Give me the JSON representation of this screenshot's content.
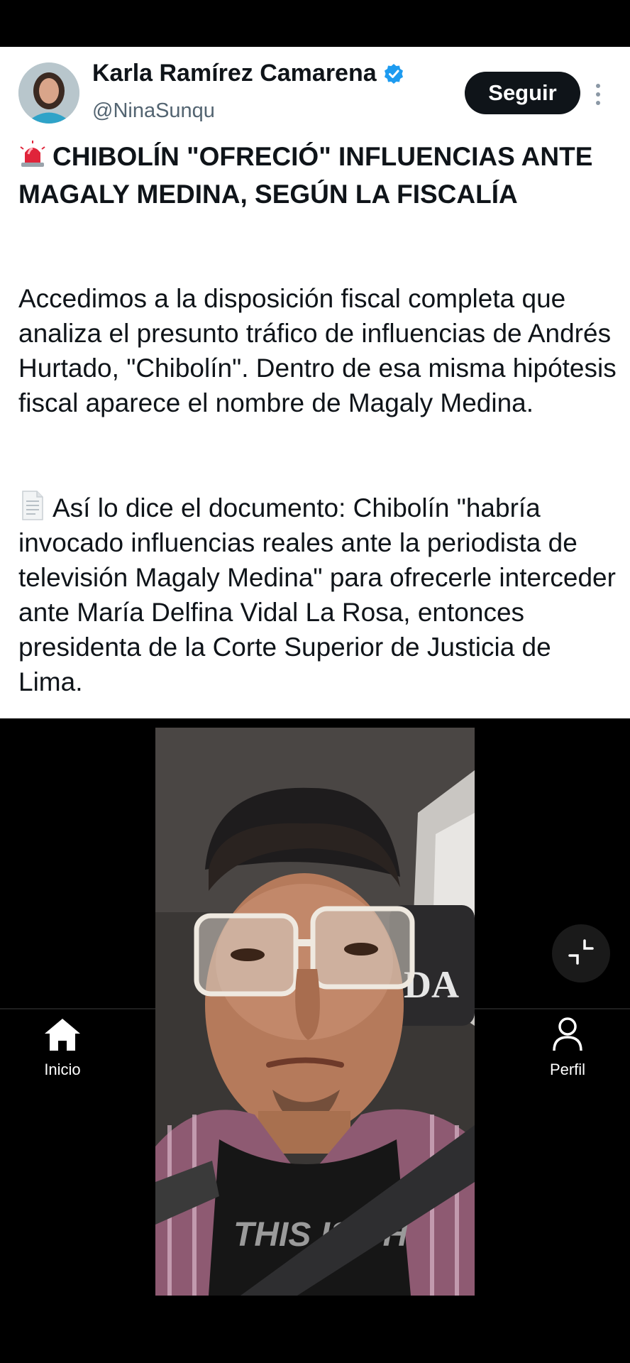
{
  "tweet": {
    "author_name": "Karla Ramírez Camarena",
    "handle": "@NinaSunqu",
    "follow_label": "Seguir",
    "headline": "CHIBOLÍN \"OFRECIÓ\" INFLUENCIAS ANTE MAGALY MEDINA, SEGÚN LA FISCALÍA",
    "paragraph_1": "Accedimos a la disposición fiscal completa que analiza el presunto tráfico de influencias de Andrés Hurtado, \"Chibolín\". Dentro de esa misma hipótesis fiscal aparece el nombre de Magaly Medina.",
    "paragraph_2": "Así lo dice el documento: Chibolín \"habría invocado influencias reales ante la periodista de televisión Magaly Medina\" para ofrecerle interceder ante María Delfina Vidal La Rosa, entonces presidenta de la Corte Superior de Justicia de Lima.",
    "icons": {
      "verified": "verified-badge-icon",
      "headline_prefix": "siren-icon",
      "paragraph_prefix": "document-icon",
      "more": "more-options-icon"
    },
    "colors": {
      "verified": "#1d9bf0",
      "follow_bg": "#0f1419",
      "handle": "#536471"
    }
  },
  "video": {
    "shirt_text": "THIS IS TH"
  },
  "bottom_nav": {
    "home_label": "Inicio",
    "profile_label": "Perfil"
  }
}
